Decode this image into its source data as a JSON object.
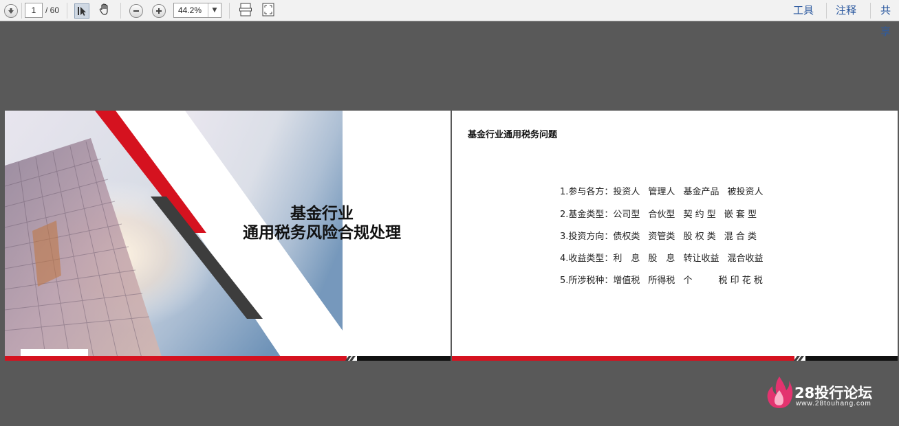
{
  "toolbar": {
    "page_current": "1",
    "page_total": "/ 60",
    "zoom": "44.2%",
    "links": [
      "工具",
      "注释",
      "共享"
    ]
  },
  "slide1": {
    "title_line1": "基金行业",
    "title_line2": "通用税务风险合规处理"
  },
  "slide2": {
    "title": "基金行业通用税务问题",
    "rows": [
      {
        "label": "1.参与各方：",
        "items": [
          "投资人",
          "管理人",
          "基金产品",
          "被投资人"
        ]
      },
      {
        "label": "2.基金类型：",
        "items": [
          "公司型",
          "合伙型",
          "契 约 型",
          "嵌 套 型"
        ]
      },
      {
        "label": "3.投资方向：",
        "items": [
          "债权类",
          "资管类",
          "股 权 类",
          "混 合 类"
        ]
      },
      {
        "label": "4.收益类型：",
        "items": [
          "利　息",
          "股　息",
          "转让收益",
          "混合收益"
        ]
      },
      {
        "label": "5.所涉税种：",
        "items": [
          "增值税",
          "所得税",
          "个　　",
          "税 印 花 税"
        ]
      }
    ]
  },
  "watermark": {
    "name": "28投行论坛",
    "url": "www.28touhang.com"
  },
  "colors": {
    "accent_red": "#d5121f",
    "dark_gray": "#3d3d3d",
    "link_blue": "#2d5aa0"
  }
}
